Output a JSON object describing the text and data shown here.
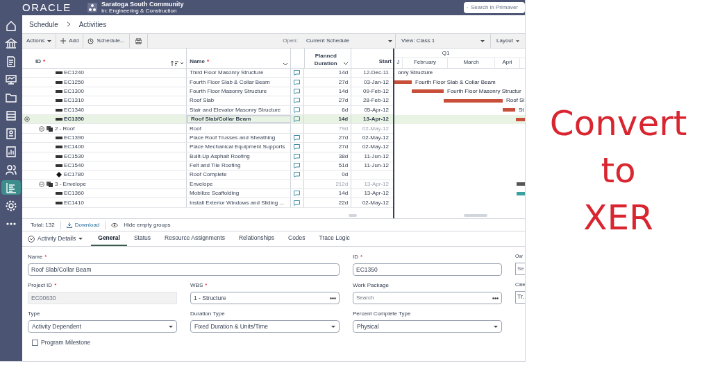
{
  "header": {
    "logo": "ORACLE",
    "project": "Saratoga South Community",
    "location": "In: Engineering & Construction",
    "search": {
      "placeholder": "Search in Primaver"
    }
  },
  "sidebar": {
    "items": [
      {
        "selected": false
      },
      {
        "selected": false
      },
      {
        "selected": false
      },
      {
        "selected": false
      },
      {
        "selected": false
      },
      {
        "selected": false
      },
      {
        "selected": false
      },
      {
        "selected": false
      },
      {
        "selected": false
      },
      {
        "selected": true
      },
      {
        "selected": false
      },
      {
        "selected": false
      }
    ]
  },
  "breadcrumb": [
    "Schedule",
    "Activities"
  ],
  "toolbar": {
    "actions": "Actions",
    "add": "Add",
    "schedule": "Schedule...",
    "open_label": "Open:",
    "open_value": "Current Schedule",
    "view": "View: Class 1",
    "layout": "Layout"
  },
  "table": {
    "columns": {
      "id": "ID",
      "id_required": "*",
      "name": "Name",
      "name_required": "*",
      "duration": "Planned Duration",
      "start": "Start"
    },
    "gantt_header": {
      "quarter": "Q1",
      "months": [
        "J",
        "February",
        "March",
        "Apri"
      ]
    },
    "rows": [
      {
        "kind": "activity",
        "id": "EC1240",
        "name": "Third Floor Masonry Structure",
        "comment": true,
        "duration": "14d",
        "start": "12-Dec-11",
        "selected": false,
        "bar_label": "onry Structure"
      },
      {
        "kind": "activity",
        "id": "EC1250",
        "name": "Fourth Floor Slab & Collar Beam",
        "comment": true,
        "duration": "27d",
        "start": "03-Jan-12",
        "selected": false,
        "bar_label": "Fourth Floor Slab & Collar Beam"
      },
      {
        "kind": "activity",
        "id": "EC1300",
        "name": "Fourth Floor Masonry Structure",
        "comment": true,
        "duration": "14d",
        "start": "09-Feb-12",
        "selected": false,
        "bar_label": "Fourth Floor Masonry Structur"
      },
      {
        "kind": "activity",
        "id": "EC1310",
        "name": "Roof Slab",
        "comment": true,
        "duration": "27d",
        "start": "28-Feb-12",
        "selected": false,
        "bar_label": "Roof Sl"
      },
      {
        "kind": "activity",
        "id": "EC1340",
        "name": "Stair and Elevator Masonry Structure",
        "comment": true,
        "duration": "6d",
        "start": "05-Apr-12",
        "selected": false,
        "bar_label": "St"
      },
      {
        "kind": "activity",
        "id": "EC1350",
        "name": "Roof Slab/Collar Beam",
        "comment": true,
        "duration": "14d",
        "start": "13-Apr-12",
        "selected": true
      },
      {
        "kind": "wbs",
        "id": "2 - Roof",
        "name": "Roof",
        "comment": false,
        "duration": "79d",
        "start": "02-May-12",
        "selected": false,
        "expanded": true
      },
      {
        "kind": "activity",
        "id": "EC1390",
        "name": "Place Roof Trusses and Sheathing",
        "comment": true,
        "duration": "27d",
        "start": "02-May-12",
        "selected": false
      },
      {
        "kind": "activity",
        "id": "EC1400",
        "name": "Place Mechanical Equipment Supports",
        "comment": true,
        "duration": "27d",
        "start": "02-May-12",
        "selected": false
      },
      {
        "kind": "activity",
        "id": "EC1530",
        "name": "Built-Up Asphalt Roofing",
        "comment": true,
        "duration": "38d",
        "start": "11-Jun-12",
        "selected": false
      },
      {
        "kind": "activity",
        "id": "EC1540",
        "name": "Felt and Tile Roofing",
        "comment": true,
        "duration": "51d",
        "start": "11-Jun-12",
        "selected": false
      },
      {
        "kind": "milestone",
        "id": "EC1780",
        "name": "Roof Complete",
        "comment": true,
        "duration": "0d",
        "selected": false
      },
      {
        "kind": "wbs",
        "id": "3 - Envelope",
        "name": "Envelope",
        "comment": false,
        "duration": "212d",
        "start": "13-Apr-12",
        "selected": false,
        "expanded": true
      },
      {
        "kind": "activity",
        "id": "EC1360",
        "name": "Mobilize Scaffolding",
        "comment": true,
        "duration": "14d",
        "start": "13-Apr-12",
        "selected": false
      },
      {
        "kind": "activity",
        "id": "EC1410",
        "name": "Install Exterior Windows and Sliding ...",
        "comment": true,
        "duration": "22d",
        "start": "02-May-12",
        "selected": false
      }
    ]
  },
  "footer": {
    "total": "Total: 132",
    "download": "Download",
    "hide_empty": "Hide empty groups"
  },
  "details": {
    "menu": "Activity Details",
    "tabs": [
      {
        "label": "General",
        "selected": true
      },
      {
        "label": "Status",
        "selected": false
      },
      {
        "label": "Resource Assignments",
        "selected": false
      },
      {
        "label": "Relationships",
        "selected": false
      },
      {
        "label": "Codes",
        "selected": false
      },
      {
        "label": "Trace Logic",
        "selected": false
      }
    ],
    "fields": [
      {
        "label": "Name",
        "required": "*",
        "kind": "wide",
        "value": "Roof Slab/Collar Beam"
      },
      {
        "label": "ID",
        "required": "*",
        "kind": "text",
        "value": "EC1350"
      },
      {
        "label": "Ow",
        "kind": "cut",
        "placeholder": "Se"
      },
      {
        "label": "Project ID",
        "required": "*",
        "kind": "readonly",
        "value": "EC00630"
      },
      {
        "label": "WBS",
        "required": "*",
        "kind": "picker",
        "value": "1 - Structure"
      },
      {
        "label": "Work Package",
        "kind": "picker",
        "placeholder": "Search"
      },
      {
        "label": "Cale",
        "kind": "cut",
        "value": "Tr."
      },
      {
        "label": "Type",
        "kind": "select",
        "value": "Activity Dependent"
      },
      {
        "label": "Duration Type",
        "kind": "select",
        "value": "Fixed Duration & Units/Time"
      },
      {
        "label": "Percent Complete Type",
        "kind": "select",
        "value": "Physical"
      }
    ],
    "checkbox": {
      "label": "Program Milestone",
      "checked": false
    }
  },
  "banner": [
    "Convert",
    "to",
    "XER"
  ]
}
